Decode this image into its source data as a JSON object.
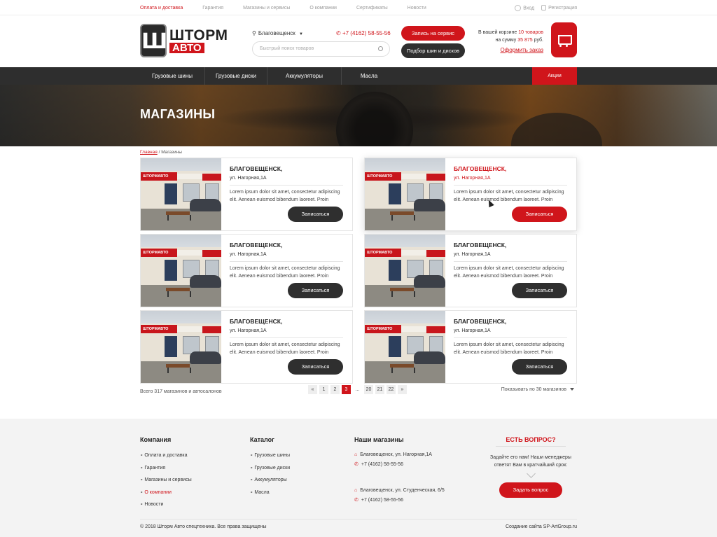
{
  "topbar": {
    "links": [
      {
        "label": "Оплата и доставка",
        "active": true
      },
      {
        "label": "Гарантия",
        "active": false
      },
      {
        "label": "Магазины и сервисы",
        "active": false
      },
      {
        "label": "О компании",
        "active": false
      },
      {
        "label": "Сертификаты",
        "active": false
      },
      {
        "label": "Новости",
        "active": false
      }
    ],
    "login": "Вход",
    "register": "Регистрация"
  },
  "header": {
    "logo_line1": "ШТОРМ",
    "logo_line2": "АВТО",
    "city": "Благовещенск",
    "phone": "+7 (4162) 58-55-56",
    "search_placeholder": "Быстрый поиск товаров",
    "service_button": "Запись на сервис",
    "tires_button": "Подбор шин и дисков",
    "cart_prefix": "В вашей корзине",
    "cart_count": "10 товаров",
    "cart_sum_prefix": "на сумму",
    "cart_sum": "35 875",
    "cart_sum_suffix": "руб.",
    "checkout_link": "Оформить заказ"
  },
  "nav": {
    "items": [
      "Грузовые шины",
      "Грузовые диски",
      "Аккумуляторы",
      "Масла"
    ],
    "sale": "Акции"
  },
  "banner": {
    "title": "МАГАЗИНЫ"
  },
  "breadcrumb": {
    "home": "Главная",
    "separator": "/",
    "current": "Магазины"
  },
  "stores": [
    {
      "city": "БЛАГОВЕЩЕНСК,",
      "address": "ул. Нагорная,1А",
      "description": "Lorem ipsum dolor sit amet, consectetur adipiscing elit. Aenean euismod bibendum laoreet. Proin",
      "button": "Записаться",
      "sign": "ШТОРМАВТО"
    },
    {
      "city": "БЛАГОВЕЩЕНСК,",
      "address": "ул. Нагорная,1А",
      "description": "Lorem ipsum dolor sit amet, consectetur adipiscing elit. Aenean euismod bibendum laoreet. Proin",
      "button": "Записаться",
      "sign": "ШТОРМАВТО"
    },
    {
      "city": "БЛАГОВЕЩЕНСК,",
      "address": "ул. Нагорная,1А",
      "description": "Lorem ipsum dolor sit amet, consectetur adipiscing elit. Aenean euismod bibendum laoreet. Proin",
      "button": "Записаться",
      "sign": "ШТОРМАВТО"
    },
    {
      "city": "БЛАГОВЕЩЕНСК,",
      "address": "ул. Нагорная,1А",
      "description": "Lorem ipsum dolor sit amet, consectetur adipiscing elit. Aenean euismod bibendum laoreet. Proin",
      "button": "Записаться",
      "sign": "ШТОРМАВТО"
    },
    {
      "city": "БЛАГОВЕЩЕНСК,",
      "address": "ул. Нагорная,1А",
      "description": "Lorem ipsum dolor sit amet, consectetur adipiscing elit. Aenean euismod bibendum laoreet. Proin",
      "button": "Записаться",
      "sign": "ШТОРМАВТО"
    },
    {
      "city": "БЛАГОВЕЩЕНСК,",
      "address": "ул. Нагорная,1А",
      "description": "Lorem ipsum dolor sit amet, consectetur adipiscing elit. Aenean euismod bibendum laoreet. Proin",
      "button": "Записаться",
      "sign": "ШТОРМАВТО"
    }
  ],
  "listing": {
    "total": "Всего 317 магазинов и автосалонов",
    "pages": [
      "«",
      "1",
      "2",
      "3",
      "...",
      "20",
      "21",
      "22",
      "»"
    ],
    "current_page": "3",
    "per_page": "Показывать по 30 магазинов"
  },
  "footer": {
    "company_title": "Компания",
    "company_links": [
      {
        "label": "Оплата и доставка",
        "active": false
      },
      {
        "label": "Гарантия",
        "active": false
      },
      {
        "label": "Магазины и сервисы",
        "active": false
      },
      {
        "label": "О компании",
        "active": true
      },
      {
        "label": "Новости",
        "active": false
      }
    ],
    "catalog_title": "Каталог",
    "catalog_links": [
      "Грузовые шины",
      "Грузовые диски",
      "Аккумуляторы",
      "Масла"
    ],
    "shops_title": "Наши магазины",
    "shops": [
      {
        "address": "Благовещенск, ул. Нагорная,1А",
        "phone": "+7 (4162) 58-55-56"
      },
      {
        "address": "Благовещенск, ул. Студенческая, 6/5",
        "phone": "+7 (4162) 58-55-56"
      }
    ],
    "ask_title": "ЕСТЬ ВОПРОС?",
    "ask_text": "Задайте его нам! Наши менеджеры ответят Вам в кратчайший срок:",
    "ask_button": "Задать вопрос",
    "copyright": "© 2018 Шторм Авто спецтехника. Все права защищены",
    "credits": "Создание сайта SP-ArtGroup.ru"
  },
  "colors": {
    "accent": "#d0151b",
    "dark": "#2e2e2e",
    "footer_bg": "#f3f3f3"
  }
}
